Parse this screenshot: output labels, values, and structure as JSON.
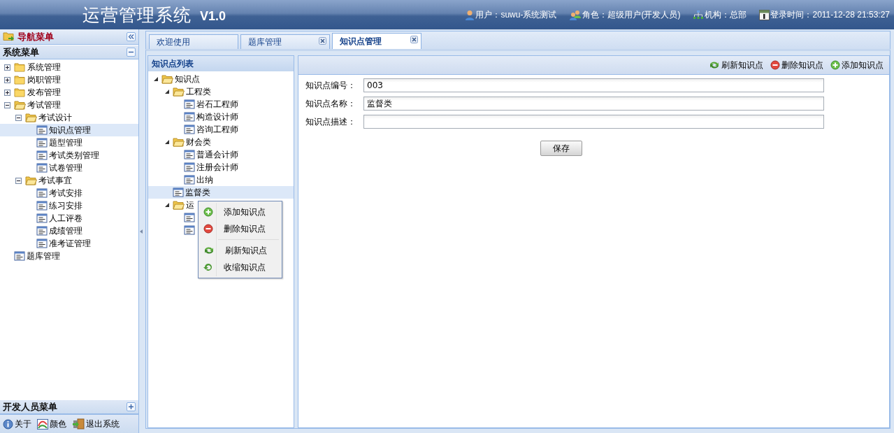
{
  "header": {
    "title": "运营管理系统",
    "version": "V1.0",
    "info": [
      {
        "kind": "user",
        "text": "用户：suwu-系统测试"
      },
      {
        "kind": "role",
        "text": "角色：超级用户(开发人员)"
      },
      {
        "kind": "org",
        "text": "机构：总部"
      },
      {
        "kind": "calendar",
        "text": "登录时间：2011-12-28 21:53:27"
      }
    ]
  },
  "nav_menu": {
    "title": "导航菜单",
    "sections": [
      {
        "title": "系统菜单",
        "expanded": true,
        "tree": [
          {
            "label": "系统管理",
            "kind": "folder",
            "expanded": false,
            "selected": false
          },
          {
            "label": "岗职管理",
            "kind": "folder",
            "expanded": false,
            "selected": false
          },
          {
            "label": "发布管理",
            "kind": "folder",
            "expanded": false,
            "selected": false
          },
          {
            "label": "考试管理",
            "kind": "folder",
            "expanded": true,
            "selected": false,
            "children": [
              {
                "label": "考试设计",
                "kind": "folder",
                "expanded": true,
                "selected": false,
                "children": [
                  {
                    "label": "知识点管理",
                    "kind": "leaf",
                    "selected": true
                  },
                  {
                    "label": "题型管理",
                    "kind": "leaf",
                    "selected": false
                  },
                  {
                    "label": "考试类别管理",
                    "kind": "leaf",
                    "selected": false
                  },
                  {
                    "label": "试卷管理",
                    "kind": "leaf",
                    "selected": false
                  }
                ]
              },
              {
                "label": "考试事宜",
                "kind": "folder",
                "expanded": true,
                "selected": false,
                "children": [
                  {
                    "label": "考试安排",
                    "kind": "leaf",
                    "selected": false
                  },
                  {
                    "label": "练习安排",
                    "kind": "leaf",
                    "selected": false
                  },
                  {
                    "label": "人工评卷",
                    "kind": "leaf",
                    "selected": false
                  },
                  {
                    "label": "成绩管理",
                    "kind": "leaf",
                    "selected": false
                  },
                  {
                    "label": "准考证管理",
                    "kind": "leaf",
                    "selected": false
                  }
                ]
              }
            ]
          },
          {
            "label": "题库管理",
            "kind": "leaf",
            "selected": false
          }
        ]
      },
      {
        "title": "开发人员菜单",
        "expanded": false
      }
    ],
    "footer_links": [
      {
        "kind": "info",
        "label": "关于"
      },
      {
        "kind": "palette",
        "label": "颜色"
      },
      {
        "kind": "exit",
        "label": "退出系统"
      }
    ]
  },
  "tabs": [
    {
      "label": "欢迎使用",
      "closable": false,
      "selected": false
    },
    {
      "label": "题库管理",
      "closable": true,
      "selected": false
    },
    {
      "label": "知识点管理",
      "closable": true,
      "selected": true
    }
  ],
  "knowledge_tree": {
    "title": "知识点列表",
    "tree": [
      {
        "label": "知识点",
        "kind": "folder",
        "expanded": true,
        "selected": false,
        "children": [
          {
            "label": "工程类",
            "kind": "folder",
            "expanded": true,
            "selected": false,
            "children": [
              {
                "label": "岩石工程师",
                "kind": "leaf",
                "selected": false
              },
              {
                "label": "构造设计师",
                "kind": "leaf",
                "selected": false
              },
              {
                "label": "咨询工程师",
                "kind": "leaf",
                "selected": false
              }
            ]
          },
          {
            "label": "财会类",
            "kind": "folder",
            "expanded": true,
            "selected": false,
            "children": [
              {
                "label": "普通会计师",
                "kind": "leaf",
                "selected": false
              },
              {
                "label": "注册会计师",
                "kind": "leaf",
                "selected": false
              },
              {
                "label": "出纳",
                "kind": "leaf",
                "selected": false
              }
            ]
          },
          {
            "label": "监督类",
            "kind": "leaf",
            "selected": true
          },
          {
            "label": "运",
            "kind": "folder",
            "expanded": true,
            "selected": false,
            "children": [
              {
                "kind": "leaf",
                "selected": false
              },
              {
                "kind": "leaf",
                "selected": false
              }
            ]
          }
        ]
      }
    ]
  },
  "context_menu": {
    "items": [
      {
        "kind": "add",
        "label": "添加知识点"
      },
      {
        "kind": "delete",
        "label": "删除知识点"
      },
      {
        "kind": "separator"
      },
      {
        "kind": "refresh",
        "label": "刷新知识点"
      },
      {
        "kind": "collapse",
        "label": "收缩知识点"
      }
    ]
  },
  "toolbar": [
    {
      "kind": "refresh",
      "label": "刷新知识点"
    },
    {
      "kind": "delete",
      "label": "删除知识点"
    },
    {
      "kind": "add",
      "label": "添加知识点"
    }
  ],
  "form": {
    "fields": [
      {
        "label": "知识点编号：",
        "value": "003"
      },
      {
        "label": "知识点名称：",
        "value": "监督类"
      },
      {
        "label": "知识点描述："
      }
    ],
    "save_button": "保存"
  }
}
